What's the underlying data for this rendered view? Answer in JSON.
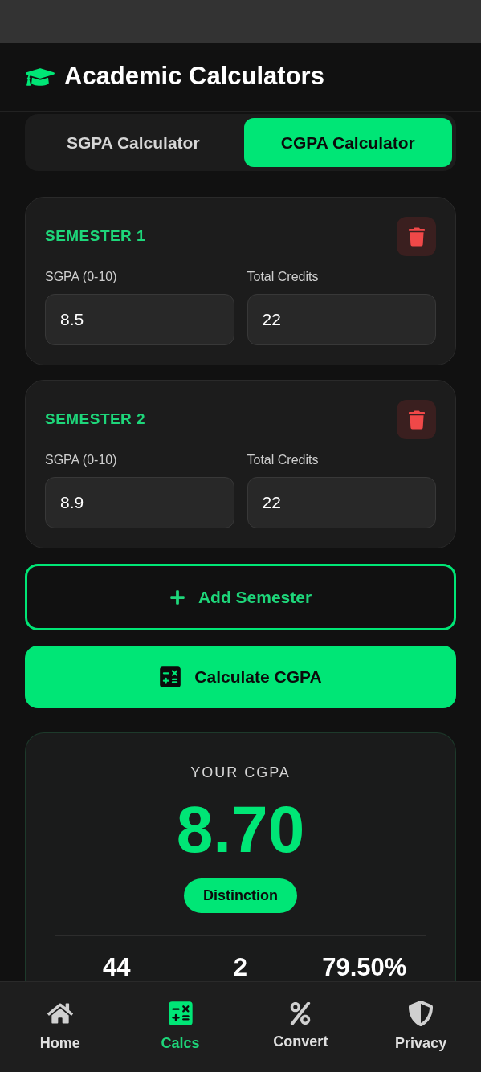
{
  "header": {
    "title": "Academic Calculators"
  },
  "tabs": [
    {
      "label": "SGPA Calculator",
      "selected": false
    },
    {
      "label": "CGPA Calculator",
      "selected": true
    }
  ],
  "semesters": [
    {
      "title": "SEMESTER 1",
      "fields": [
        {
          "label": "SGPA (0-10)",
          "value": "8.5"
        },
        {
          "label": "Total Credits",
          "value": "22"
        }
      ]
    },
    {
      "title": "SEMESTER 2",
      "fields": [
        {
          "label": "SGPA (0-10)",
          "value": "8.9"
        },
        {
          "label": "Total Credits",
          "value": "22"
        }
      ]
    }
  ],
  "add_button": {
    "label": "Add Semester"
  },
  "calculate_button": {
    "label": "Calculate CGPA"
  },
  "result": {
    "heading": "YOUR CGPA",
    "value": "8.70",
    "badge": "Distinction",
    "stats": [
      "44",
      "2",
      "79.50%"
    ]
  },
  "bottom_nav": [
    {
      "label": "Home",
      "kind": "home",
      "selected": false
    },
    {
      "label": "Calcs",
      "kind": "calcs",
      "selected": true
    },
    {
      "label": "Convert",
      "kind": "convert",
      "selected": false
    },
    {
      "label": "Privacy",
      "kind": "privacy",
      "selected": false
    }
  ]
}
